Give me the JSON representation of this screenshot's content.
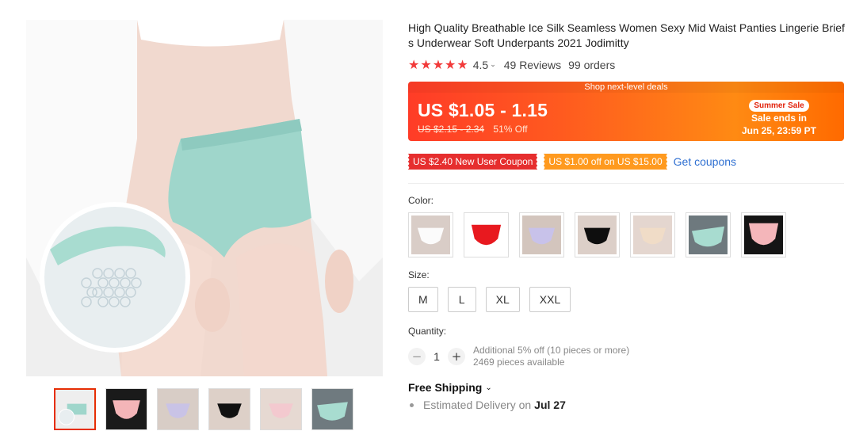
{
  "product": {
    "title": "High Quality Breathable Ice Silk Seamless Women Sexy Mid Waist Panties Lingerie Briefs Underwear Soft Underpants 2021 Jodimitty",
    "rating": "4.5",
    "rating_stars": 4.5,
    "reviews": "49 Reviews",
    "orders": "99 orders"
  },
  "deal": {
    "banner_top": "Shop next-level deals",
    "price": "US $1.05 - 1.15",
    "old_price": "US $2.15 - 2.34",
    "discount": "51% Off",
    "sale_badge": "Summer Sale",
    "sale_ends_label": "Sale ends in",
    "sale_ends_time": "Jun 25, 23:59 PT"
  },
  "coupons": {
    "new_user": "US $2.40 New User Coupon",
    "store": "US $1.00 off on US $15.00",
    "get_link": "Get coupons"
  },
  "color": {
    "label": "Color:",
    "swatches": [
      "white",
      "red",
      "lavender",
      "black",
      "beige",
      "mint",
      "pink"
    ]
  },
  "size": {
    "label": "Size:",
    "options": [
      "M",
      "L",
      "XL",
      "XXL"
    ]
  },
  "quantity": {
    "label": "Quantity:",
    "value": "1",
    "minus": "−",
    "plus": "+",
    "discount_note": "Additional 5% off (10 pieces or more)",
    "available": "2469 pieces available"
  },
  "shipping": {
    "title": "Free Shipping",
    "delivery_label": "Estimated Delivery on",
    "delivery_date": "Jul 27"
  },
  "colors": {
    "accent_red": "#e62e04",
    "star": "#f23a3a",
    "link": "#2e6fd1"
  }
}
